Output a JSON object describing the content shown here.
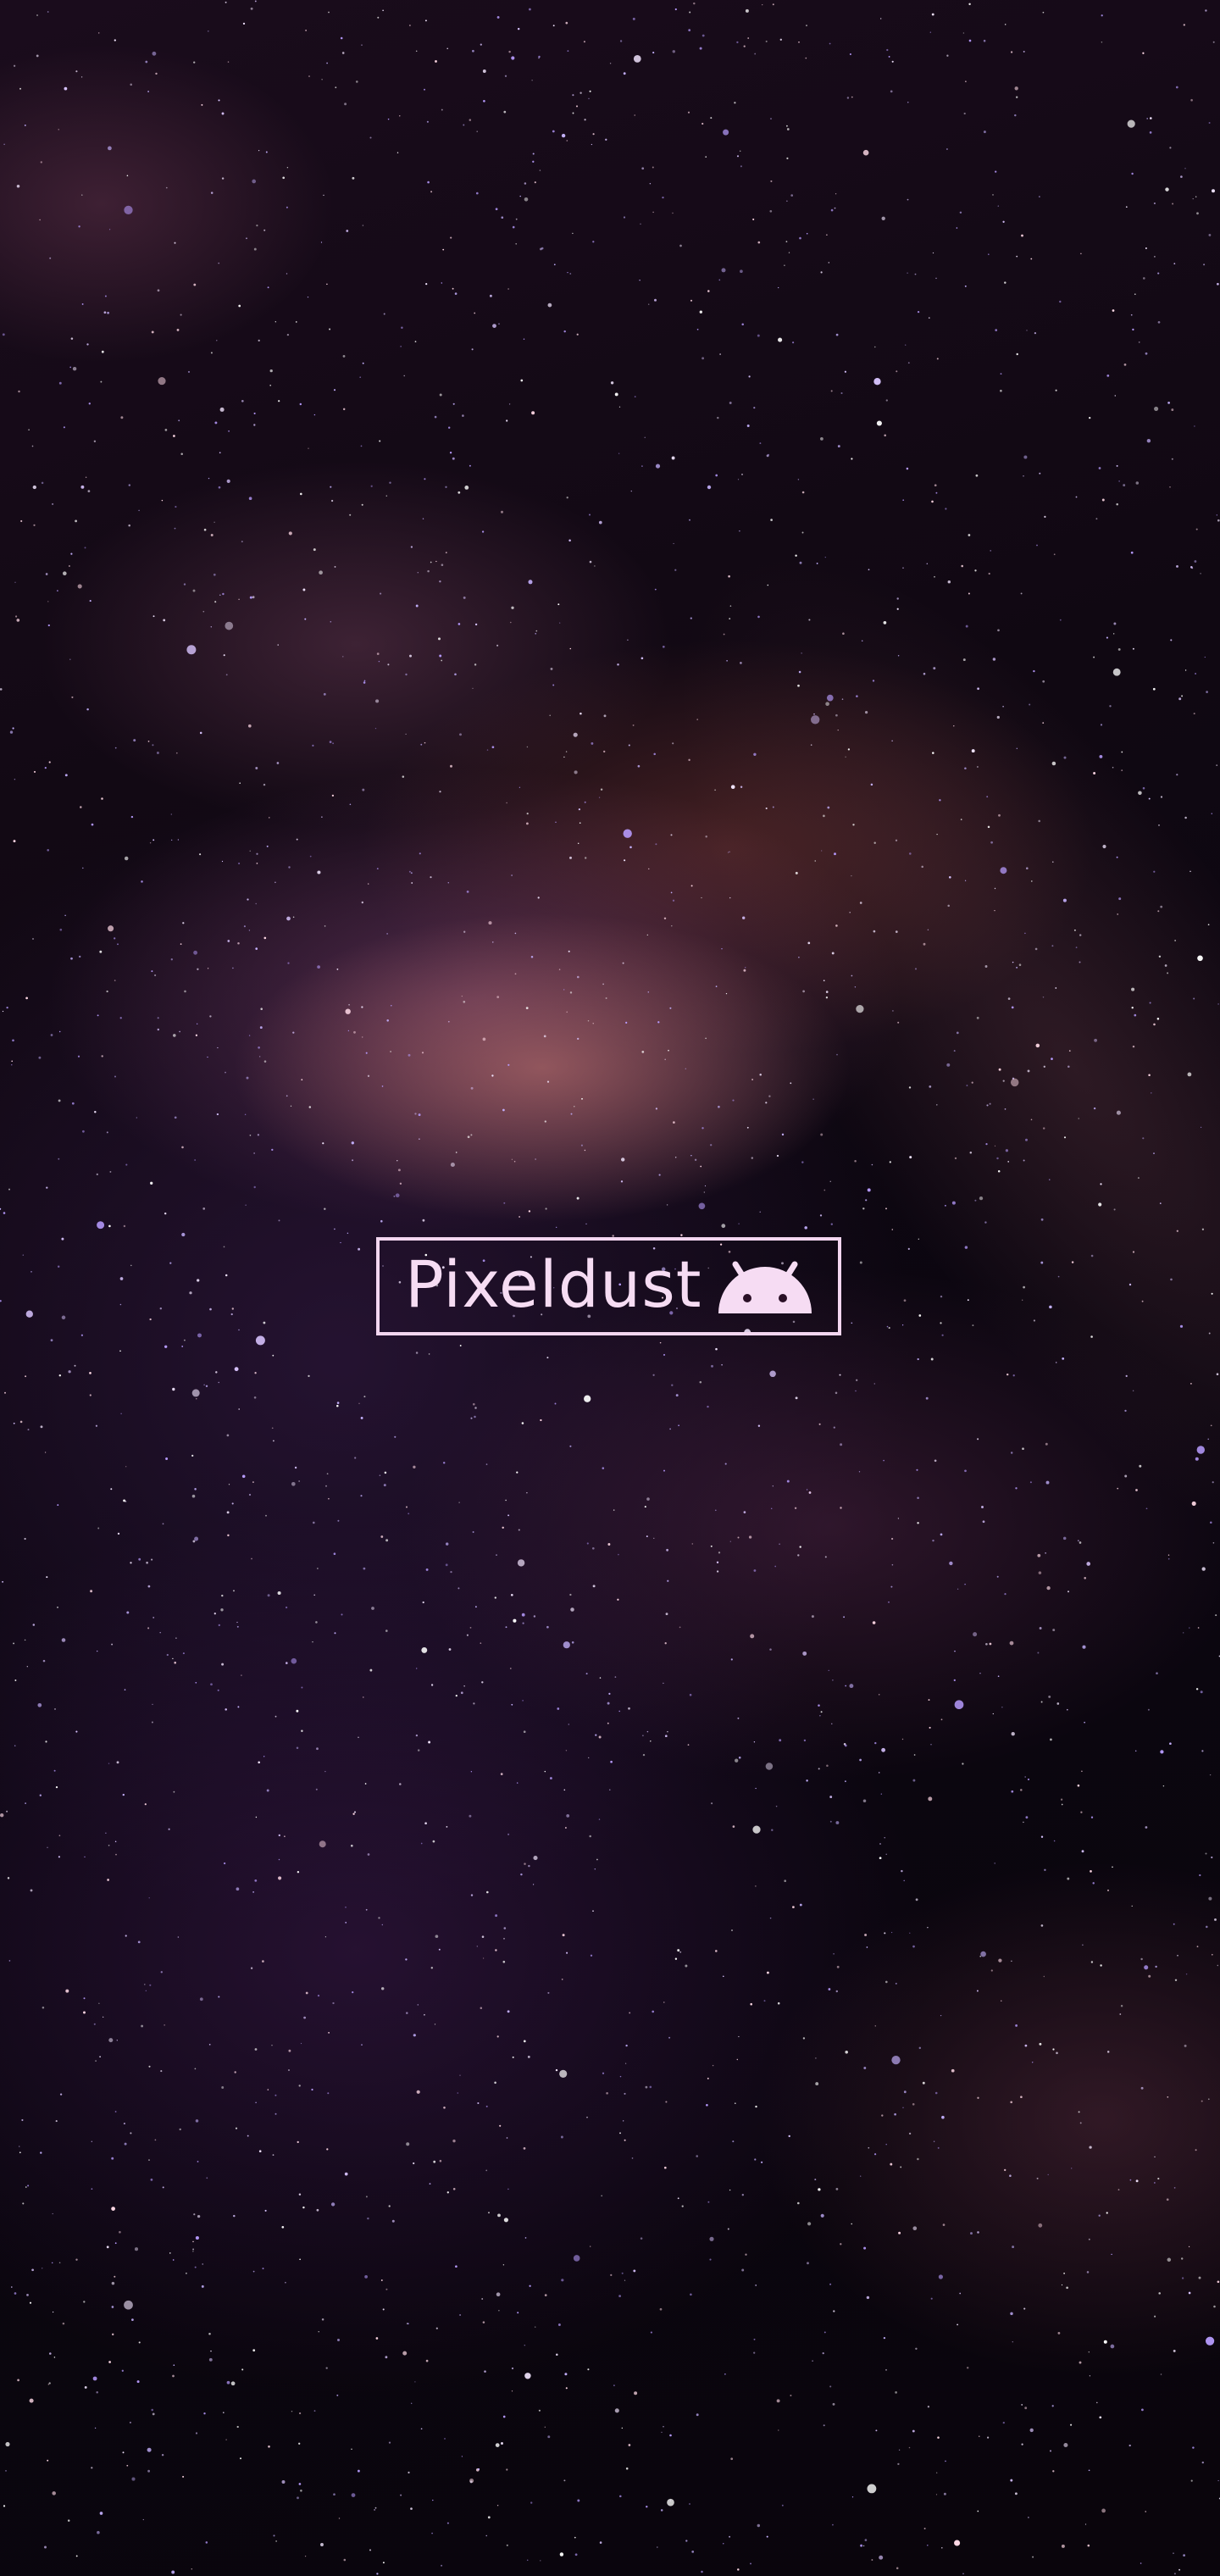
{
  "wallpaper": {
    "brand_name": "Pixeldust",
    "logo_icon": "android-head-icon",
    "colors": {
      "logo": "#f3d6f0",
      "sky": "#0a050c",
      "nebula": "#d68278"
    }
  }
}
